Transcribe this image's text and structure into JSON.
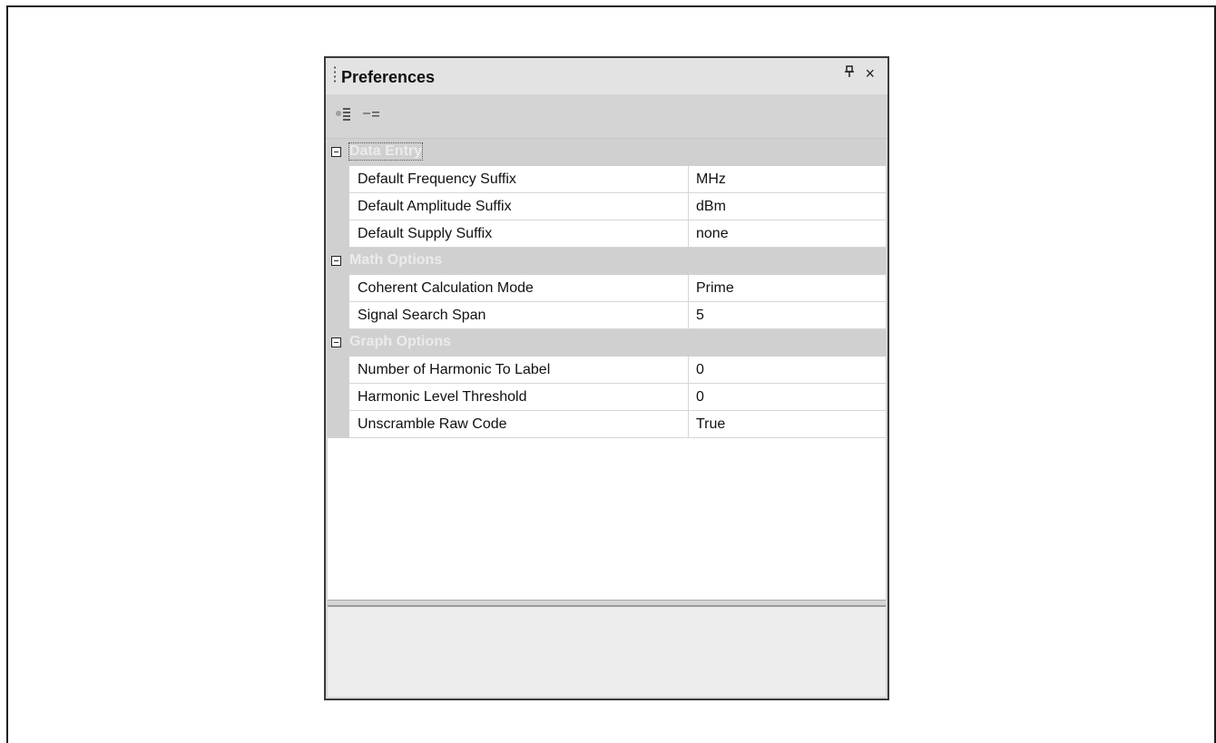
{
  "panel": {
    "title": "Preferences",
    "pin_glyph": "ᵖ",
    "close_glyph": "×"
  },
  "toolbar": {
    "buttons": [
      {
        "icon": "categorized-icon"
      },
      {
        "icon": "alphabetical-icon"
      }
    ]
  },
  "categories": [
    {
      "label": "Data Entry",
      "expanded": true,
      "properties": [
        {
          "name": "Default Frequency Suffix",
          "value": "MHz"
        },
        {
          "name": "Default Amplitude Suffix",
          "value": "dBm"
        },
        {
          "name": "Default Supply Suffix",
          "value": "none"
        }
      ]
    },
    {
      "label": "Math Options",
      "expanded": true,
      "properties": [
        {
          "name": "Coherent Calculation Mode",
          "value": "Prime"
        },
        {
          "name": "Signal Search Span",
          "value": "5"
        }
      ]
    },
    {
      "label": "Graph Options",
      "expanded": true,
      "properties": [
        {
          "name": "Number of Harmonic To Label",
          "value": "0"
        },
        {
          "name": "Harmonic Level Threshold",
          "value": "0"
        },
        {
          "name": "Unscramble Raw Code",
          "value": "True"
        }
      ]
    }
  ],
  "description": {
    "text": ""
  }
}
